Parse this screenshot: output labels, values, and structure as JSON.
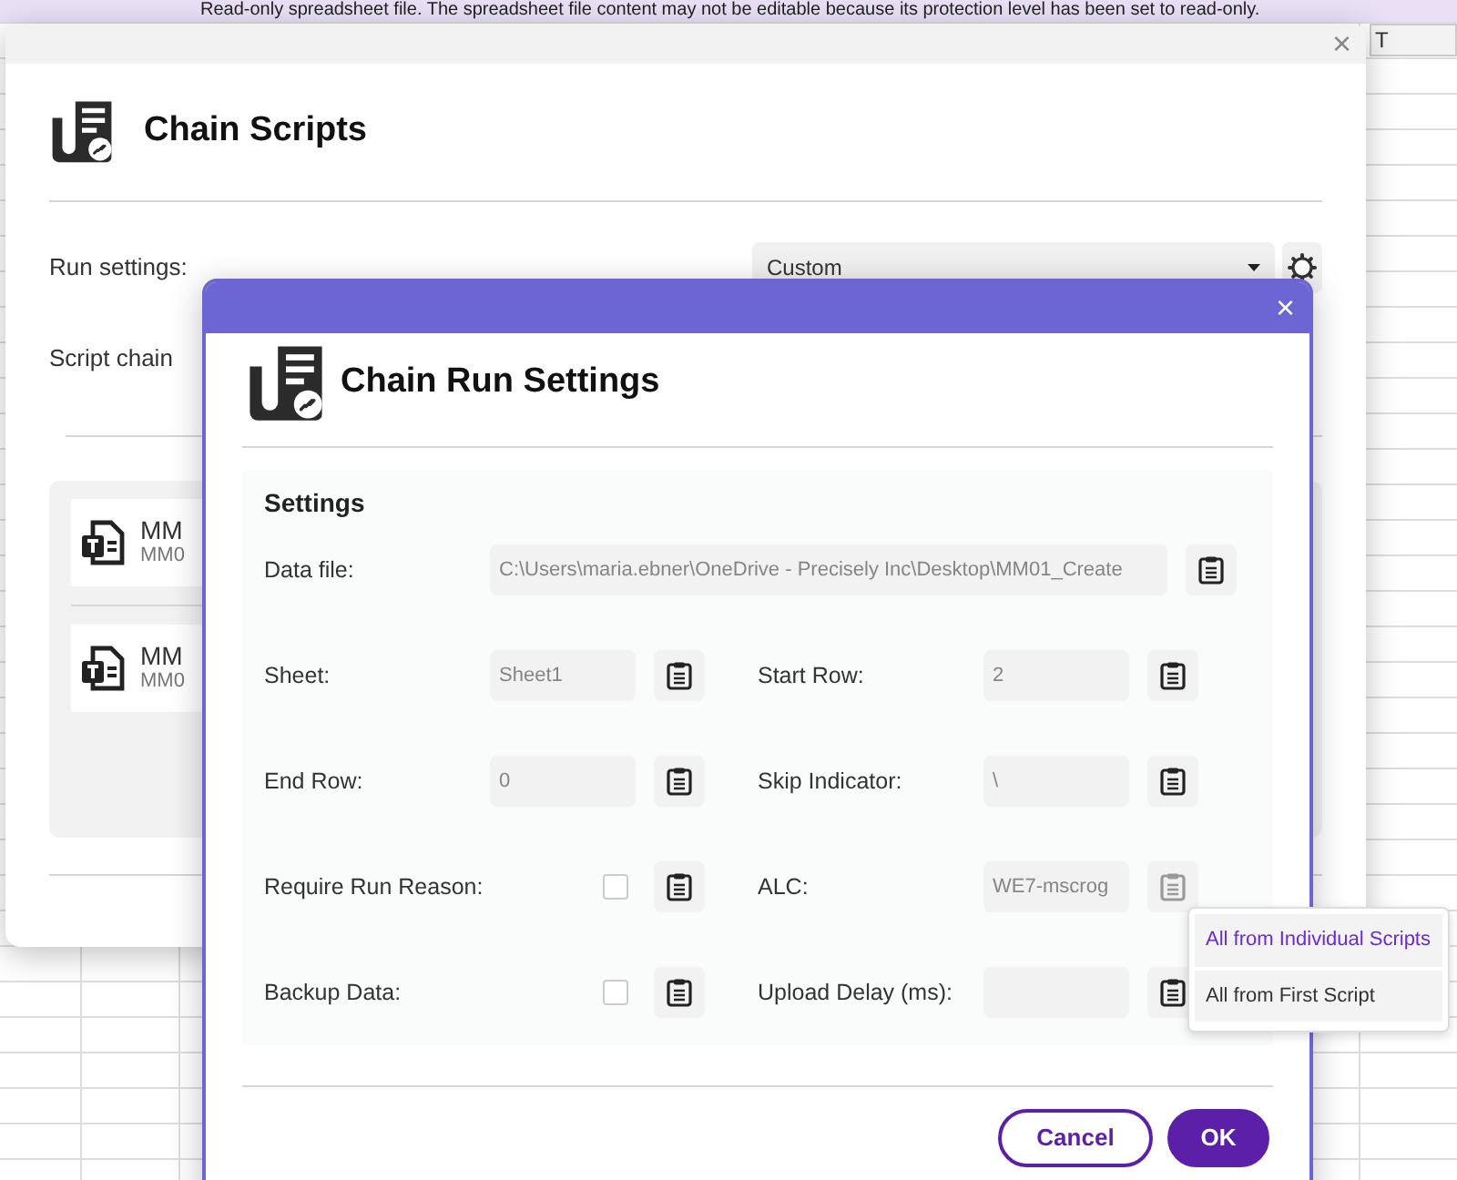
{
  "banner": {
    "text": "Read-only spreadsheet file. The spreadsheet file content may not be editable because its protection level has been set to read-only."
  },
  "sheet": {
    "column_header": "T"
  },
  "chain_dialog": {
    "close": "×",
    "title": "Chain Scripts",
    "run_settings": {
      "label": "Run settings:",
      "value": "Custom"
    },
    "script_chain_label": "Script chain",
    "scripts": [
      {
        "title": "MM",
        "subtitle": "MM0"
      },
      {
        "title": "MM",
        "subtitle": "MM0"
      }
    ]
  },
  "settings_dialog": {
    "close": "×",
    "title": "Chain Run Settings",
    "section": "Settings",
    "rows": [
      [
        {
          "kind": "text",
          "label": "Data file:",
          "value": "C:\\Users\\maria.ebner\\OneDrive - Precisely Inc\\Desktop\\MM01_Create",
          "wide": true,
          "copy_disabled": false
        }
      ],
      [
        {
          "kind": "text",
          "label": "Sheet:",
          "value": "Sheet1",
          "copy_disabled": false
        },
        {
          "kind": "text",
          "label": "Start Row:",
          "value": "2",
          "copy_disabled": false
        }
      ],
      [
        {
          "kind": "text",
          "label": "End Row:",
          "value": "0",
          "copy_disabled": false
        },
        {
          "kind": "text",
          "label": "Skip Indicator:",
          "value": "\\",
          "copy_disabled": false
        }
      ],
      [
        {
          "kind": "checkbox",
          "label": "Require Run Reason:",
          "checked": false,
          "copy_disabled": false
        },
        {
          "kind": "text",
          "label": "ALC:",
          "value": "WE7-mscrog",
          "copy_disabled": true
        }
      ],
      [
        {
          "kind": "checkbox",
          "label": "Backup Data:",
          "checked": false,
          "copy_disabled": false
        },
        {
          "kind": "text",
          "label": "Upload Delay (ms):",
          "copy_disabled": false
        }
      ]
    ],
    "menu": [
      {
        "label": "All from Individual Scripts",
        "selected": true
      },
      {
        "label": "All from First Script",
        "selected": false
      }
    ],
    "buttons": [
      {
        "label": "Cancel",
        "kind": "secondary"
      },
      {
        "label": "OK",
        "kind": "primary"
      }
    ]
  }
}
